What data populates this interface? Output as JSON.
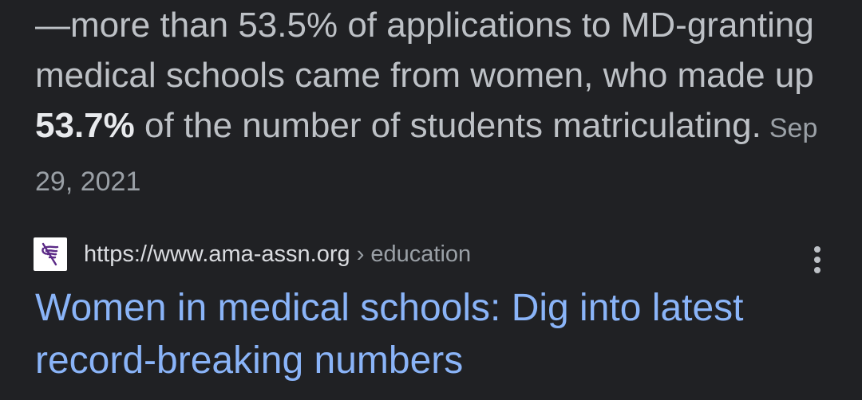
{
  "snippet": {
    "text_before": "—more than 53.5% of applications to MD-granting medical schools came from women, who made up ",
    "highlight": "53.7%",
    "text_after": " of the number of students matriculating.",
    "date": "Sep 29, 2021"
  },
  "result": {
    "url_base": "https://www.ama-assn.org",
    "url_path": " › education",
    "title": "Women in medical schools: Dig into latest record-breaking numbers",
    "favicon_icon": "ama-caduceus-logo-icon",
    "menu_icon": "more-vert-icon"
  },
  "colors": {
    "background": "#202124",
    "snippet_text": "#bdc1c6",
    "link_title": "#8ab4f8",
    "favicon_purple": "#5b2a86"
  }
}
